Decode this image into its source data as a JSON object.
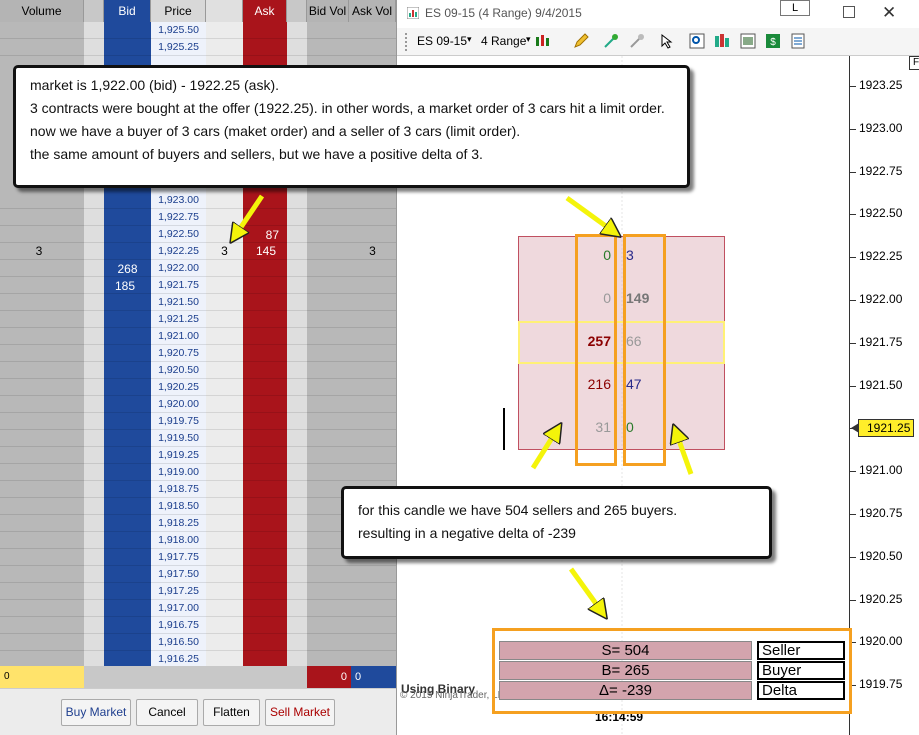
{
  "dom": {
    "headers": {
      "volume": "Volume",
      "bid": "Bid",
      "price": "Price",
      "ask": "Ask",
      "bid_vol": "Bid Vol",
      "ask_vol": "Ask Vol"
    },
    "prices": [
      "1,925.50",
      "1,925.25",
      "1,923.00",
      "1,922.75",
      "1,922.50",
      "1,922.25",
      "1,922.00",
      "1,921.75",
      "1,921.50",
      "1,921.25",
      "1,921.00",
      "1,920.75",
      "1,920.50",
      "1,920.25",
      "1,920.00",
      "1,919.75",
      "1,919.50",
      "1,919.25",
      "1,919.00",
      "1,918.75",
      "1,918.50",
      "1,918.25",
      "1,918.00",
      "1,917.75",
      "1,917.50",
      "1,917.25",
      "1,917.00",
      "1,916.75",
      "1,916.50",
      "1,916.25"
    ],
    "row_1922_25": {
      "volume": "3",
      "last": "3",
      "ask": "145",
      "ask_vol": "3"
    },
    "row_1922_50": {
      "ask": "87"
    },
    "row_1922_00": {
      "bid": "268"
    },
    "row_1921_75": {
      "bid": "185"
    },
    "bottom": {
      "pnl": "0",
      "bid_vol_total": "0",
      "ask_vol_total": "0"
    },
    "buttons": {
      "buy_market": "Buy Market",
      "cancel": "Cancel",
      "flatten": "Flatten",
      "sell_market": "Sell Market"
    }
  },
  "chart": {
    "window_title": "ES 09-15 (4 Range)  9/4/2015",
    "window_button": "L",
    "instrument": "ES 09-15",
    "period": "4 Range",
    "f_button": "F",
    "price_ticks": [
      "1923.25",
      "1923.00",
      "1922.75",
      "1922.50",
      "1922.25",
      "1922.00",
      "1921.75",
      "1921.50",
      "1921.25",
      "1921.00",
      "1920.75",
      "1920.50",
      "1920.25",
      "1920.00",
      "1919.75"
    ],
    "current_price": "1921.25",
    "time_label": "16:14:59",
    "watermark": "Using Binary",
    "copyright": "© 2015 NinjaTrader, LLC",
    "footprint": {
      "sell": [
        "0",
        "0",
        "257",
        "216",
        "31"
      ],
      "buy": [
        "3",
        "149",
        "66",
        "47",
        "0"
      ]
    },
    "summary": {
      "seller_value": "S= 504",
      "buyer_value": "B= 265",
      "delta_value": "Δ= -239",
      "seller_label": "Seller",
      "buyer_label": "Buyer",
      "delta_label": "Delta"
    }
  },
  "annotations": {
    "callout1": [
      "market is 1,922.00 (bid) - 1922.25 (ask).",
      "3 contracts were bought at the offer (1922.25). in other words, a market order of 3 cars hit a limit order.",
      "now we have a buyer of 3 cars (maket order) and a seller of 3 cars (limit order).",
      "the same amount of buyers and sellers, but we have a positive delta of 3."
    ],
    "callout2": [
      "for this candle we have 504 sellers and 265 buyers.",
      "resulting in a negative delta of -239"
    ]
  },
  "colors": {
    "bid": "#1f4a9c",
    "ask": "#a9141b",
    "highlight": "#ffee2a",
    "orange": "#f5a020",
    "arrow": "#f4f40a"
  }
}
